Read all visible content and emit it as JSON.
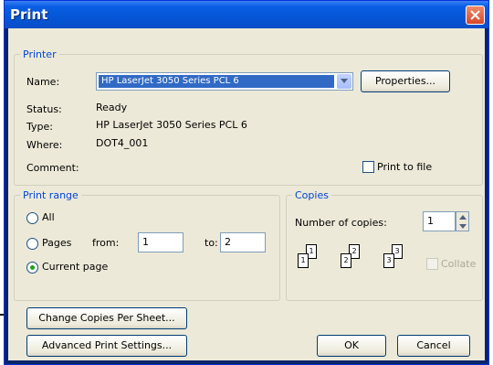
{
  "window": {
    "title": "Print",
    "close_icon": "close-icon"
  },
  "printer_group": {
    "legend": "Printer",
    "name_label": "Name:",
    "name_value": "HP LaserJet 3050 Series PCL 6",
    "properties_button": "Properties...",
    "status_label": "Status:",
    "status_value": "Ready",
    "type_label": "Type:",
    "type_value": "HP LaserJet 3050 Series PCL 6",
    "where_label": "Where:",
    "where_value": "DOT4_001",
    "comment_label": "Comment:",
    "print_to_file_label": "Print to file",
    "print_to_file_checked": false
  },
  "print_range_group": {
    "legend": "Print range",
    "all_label": "All",
    "pages_label": "Pages",
    "from_label": "from:",
    "from_value": "1",
    "to_label": "to:",
    "to_value": "2",
    "current_page_label": "Current page",
    "selected": "current_page"
  },
  "copies_group": {
    "legend": "Copies",
    "number_label": "Number of copies:",
    "number_value": "1",
    "collate_label": "Collate",
    "collate_enabled": false
  },
  "buttons": {
    "change_copies": "Change Copies Per Sheet...",
    "advanced": "Advanced Print Settings...",
    "ok": "OK",
    "cancel": "Cancel"
  },
  "collate_pages": [
    {
      "back": "1",
      "front": "1"
    },
    {
      "back": "2",
      "front": "2"
    },
    {
      "back": "3",
      "front": "3"
    }
  ],
  "colors": {
    "titlebar": "#0a5fe4",
    "group_legend": "#0046d5",
    "selection": "#316ac5",
    "dialog_face": "#ece9d8"
  }
}
